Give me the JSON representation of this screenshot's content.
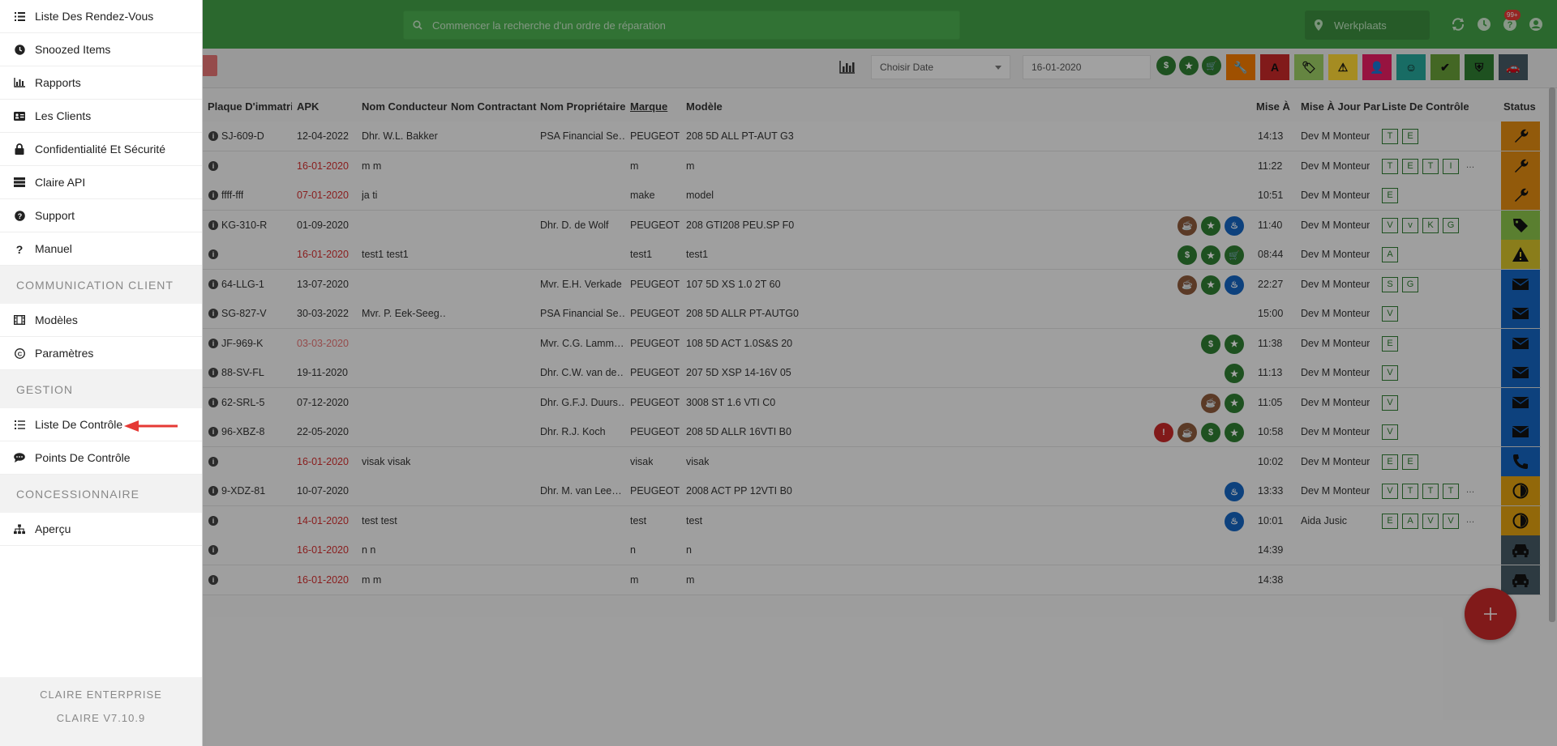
{
  "search": {
    "placeholder": "Commencer la recherche d'un ordre de réparation"
  },
  "location": {
    "label": "Werkplaats"
  },
  "notif_badge": "99+",
  "toolbar": {
    "date_select": "Choisir Date",
    "date_value": "16-01-2020"
  },
  "filters": {
    "circle": [
      {
        "icon": "dollar-icon",
        "color": "#2e7d32"
      },
      {
        "icon": "star-icon",
        "color": "#2e7d32"
      },
      {
        "icon": "cart-icon",
        "color": "#2e7d32"
      }
    ],
    "square": [
      {
        "icon": "wrench-icon",
        "color": "#f57c00"
      },
      {
        "icon": "letter-a-icon",
        "color": "#c62828"
      },
      {
        "icon": "tag-icon",
        "color": "#9ccc65"
      },
      {
        "icon": "warning-icon",
        "color": "#fdd835"
      },
      {
        "icon": "user-plus-icon",
        "color": "#e91e63"
      },
      {
        "icon": "smiley-icon",
        "color": "#26a69a"
      },
      {
        "icon": "double-check-icon",
        "color": "#689f38"
      },
      {
        "icon": "shield-icon",
        "color": "#2e7d32"
      },
      {
        "icon": "car-icon",
        "color": "#455a64"
      }
    ]
  },
  "table": {
    "headers": [
      "Plaque D'immatric",
      "APK",
      "Nom Conducteur",
      "Nom Contractant",
      "Nom Propriétaire",
      "Marque",
      "Modèle",
      "Mise À",
      "Mise À Jour Par",
      "Liste De Contrôle",
      "Status"
    ],
    "rows": [
      {
        "plaque": "SJ-609-D",
        "apk": "12-04-2022",
        "apk_style": "",
        "cond": "Dhr. W.L. Bakker",
        "prop": "PSA Financial Se…",
        "marque": "PEUGEOT",
        "modele": "208 5D ALL PT-AUT G3",
        "mise": "14:13",
        "par": "Dev M Monteur",
        "checks": [
          "T",
          "E"
        ],
        "more": "",
        "icons": [],
        "status": "wrench",
        "status_color": "#e08a12"
      },
      {
        "plaque": "",
        "apk": "16-01-2020",
        "apk_style": "red",
        "cond": "m m",
        "prop": "",
        "marque": "m",
        "modele": "m",
        "mise": "11:22",
        "par": "Dev M Monteur",
        "checks": [
          "T",
          "E",
          "T",
          "I"
        ],
        "more": "…",
        "icons": [],
        "status": "wrench",
        "status_color": "#e08a12"
      },
      {
        "plaque": "ffff-fff",
        "apk": "07-01-2020",
        "apk_style": "red",
        "cond": "ja ti",
        "prop": "",
        "marque": "make",
        "modele": "model",
        "mise": "10:51",
        "par": "Dev M Monteur",
        "checks": [
          "E"
        ],
        "more": "",
        "icons": [],
        "status": "wrench",
        "status_color": "#e08a12"
      },
      {
        "plaque": "KG-310-R",
        "apk": "01-09-2020",
        "apk_style": "",
        "cond": "",
        "prop": "Dhr. D. de Wolf",
        "marque": "PEUGEOT",
        "modele": "208 GTI208 PEU.SP F0",
        "mise": "11:40",
        "par": "Dev M Monteur",
        "checks": [
          "V",
          "v",
          "K",
          "G"
        ],
        "more": "",
        "icons": [
          {
            "c": "#8d5a3b",
            "t": "☕"
          },
          {
            "c": "#2e7d32",
            "t": "★"
          },
          {
            "c": "#1565c0",
            "t": "♨"
          }
        ],
        "status": "tag",
        "status_color": "#8bc34a"
      },
      {
        "plaque": "",
        "apk": "16-01-2020",
        "apk_style": "red",
        "cond": "test1 test1",
        "prop": "",
        "marque": "test1",
        "modele": "test1",
        "mise": "08:44",
        "par": "Dev M Monteur",
        "checks": [
          "A"
        ],
        "more": "",
        "icons": [
          {
            "c": "#2e7d32",
            "t": "$"
          },
          {
            "c": "#2e7d32",
            "t": "★"
          },
          {
            "c": "#2e7d32",
            "t": "🛒"
          }
        ],
        "status": "warning",
        "status_color": "#d4c12a"
      },
      {
        "plaque": "64-LLG-1",
        "apk": "13-07-2020",
        "apk_style": "",
        "cond": "",
        "prop": "Mvr. E.H. Verkade",
        "marque": "PEUGEOT",
        "modele": "107 5D XS 1.0 2T 60",
        "mise": "22:27",
        "par": "Dev M Monteur",
        "checks": [
          "S",
          "G"
        ],
        "more": "",
        "icons": [
          {
            "c": "#8d5a3b",
            "t": "☕"
          },
          {
            "c": "#2e7d32",
            "t": "★"
          },
          {
            "c": "#1565c0",
            "t": "♨"
          }
        ],
        "status": "mail",
        "status_color": "#1565c0"
      },
      {
        "plaque": "SG-827-V",
        "apk": "30-03-2022",
        "apk_style": "",
        "cond": "Mvr. P. Eek-Seeg…",
        "prop": "PSA Financial Se…",
        "marque": "PEUGEOT",
        "modele": "208 5D ALLR PT-AUTG0",
        "mise": "15:00",
        "par": "Dev M Monteur",
        "checks": [
          "V"
        ],
        "more": "",
        "icons": [],
        "status": "mail",
        "status_color": "#1565c0"
      },
      {
        "plaque": "JF-969-K",
        "apk": "03-03-2020",
        "apk_style": "pink",
        "cond": "",
        "prop": "Mvr. C.G. Lamm…",
        "marque": "PEUGEOT",
        "modele": "108 5D ACT 1.0S&S 20",
        "mise": "11:38",
        "par": "Dev M Monteur",
        "checks": [
          "E"
        ],
        "more": "",
        "icons": [
          {
            "c": "#2e7d32",
            "t": "$"
          },
          {
            "c": "#2e7d32",
            "t": "★"
          }
        ],
        "status": "mail",
        "status_color": "#1565c0"
      },
      {
        "plaque": "88-SV-FL",
        "apk": "19-11-2020",
        "apk_style": "",
        "cond": "",
        "prop": "Dhr. C.W. van de…",
        "marque": "PEUGEOT",
        "modele": "207 5D XSP 14-16V 05",
        "mise": "11:13",
        "par": "Dev M Monteur",
        "checks": [
          "V"
        ],
        "more": "",
        "icons": [
          {
            "c": "#2e7d32",
            "t": "★"
          }
        ],
        "status": "mail",
        "status_color": "#1565c0"
      },
      {
        "plaque": "62-SRL-5",
        "apk": "07-12-2020",
        "apk_style": "",
        "cond": "",
        "prop": "Dhr. G.F.J. Duurs…",
        "marque": "PEUGEOT",
        "modele": "3008 ST 1.6 VTI C0",
        "mise": "11:05",
        "par": "Dev M Monteur",
        "checks": [
          "V"
        ],
        "more": "",
        "icons": [
          {
            "c": "#8d5a3b",
            "t": "☕"
          },
          {
            "c": "#2e7d32",
            "t": "★"
          }
        ],
        "status": "mail",
        "status_color": "#1565c0"
      },
      {
        "plaque": "96-XBZ-8",
        "apk": "22-05-2020",
        "apk_style": "",
        "cond": "",
        "prop": "Dhr. R.J. Koch",
        "marque": "PEUGEOT",
        "modele": "208 5D ALLR 16VTI B0",
        "mise": "10:58",
        "par": "Dev M Monteur",
        "checks": [
          "V"
        ],
        "more": "",
        "icons": [
          {
            "c": "#c62828",
            "t": "!"
          },
          {
            "c": "#8d5a3b",
            "t": "☕"
          },
          {
            "c": "#2e7d32",
            "t": "$"
          },
          {
            "c": "#2e7d32",
            "t": "★"
          }
        ],
        "status": "mail",
        "status_color": "#1565c0"
      },
      {
        "plaque": "",
        "apk": "16-01-2020",
        "apk_style": "red",
        "cond": "visak visak",
        "prop": "",
        "marque": "visak",
        "modele": "visak",
        "mise": "10:02",
        "par": "Dev M Monteur",
        "checks": [
          "E",
          "E"
        ],
        "more": "",
        "icons": [],
        "status": "phone",
        "status_color": "#1565c0"
      },
      {
        "plaque": "9-XDZ-81",
        "apk": "10-07-2020",
        "apk_style": "",
        "cond": "",
        "prop": "Dhr. M. van Lee…",
        "marque": "PEUGEOT",
        "modele": "2008 ACT PP 12VTI B0",
        "mise": "13:33",
        "par": "Dev M Monteur",
        "checks": [
          "V",
          "T",
          "T",
          "T"
        ],
        "more": "…",
        "icons": [
          {
            "c": "#1565c0",
            "t": "♨"
          }
        ],
        "status": "clock",
        "status_color": "#e0a010"
      },
      {
        "plaque": "",
        "apk": "14-01-2020",
        "apk_style": "red",
        "cond": "test test",
        "prop": "",
        "marque": "test",
        "modele": "test",
        "mise": "10:01",
        "par": "Aida Jusic",
        "checks": [
          "E",
          "A",
          "V",
          "V"
        ],
        "more": "…",
        "icons": [
          {
            "c": "#1565c0",
            "t": "♨"
          }
        ],
        "status": "clock",
        "status_color": "#e0a010"
      },
      {
        "plaque": "",
        "apk": "16-01-2020",
        "apk_style": "red",
        "cond": "n n",
        "prop": "",
        "marque": "n",
        "modele": "n",
        "mise": "14:39",
        "par": "",
        "checks": [],
        "more": "",
        "icons": [],
        "status": "car",
        "status_color": "#455a64"
      },
      {
        "plaque": "",
        "apk": "16-01-2020",
        "apk_style": "red",
        "cond": "m m",
        "prop": "",
        "marque": "m",
        "modele": "m",
        "mise": "14:38",
        "par": "",
        "checks": [],
        "more": "",
        "icons": [],
        "status": "car",
        "status_color": "#455a64"
      }
    ]
  },
  "sidebar": {
    "items": [
      {
        "label": "Liste Des Rendez-Vous",
        "icon": "list-icon"
      },
      {
        "label": "Snoozed Items",
        "icon": "clock-icon"
      },
      {
        "label": "Rapports",
        "icon": "bar-chart-icon"
      },
      {
        "label": "Les Clients",
        "icon": "id-card-icon"
      },
      {
        "label": "Confidentialité Et Sécurité",
        "icon": "lock-icon"
      },
      {
        "label": "Claire API",
        "icon": "server-icon"
      },
      {
        "label": "Support",
        "icon": "question-circle-icon"
      },
      {
        "label": "Manuel",
        "icon": "question-icon"
      }
    ],
    "section_comm": "COMMUNICATION CLIENT",
    "comm_items": [
      {
        "label": "Modèles",
        "icon": "film-icon"
      },
      {
        "label": "Paramètres",
        "icon": "copyright-icon"
      }
    ],
    "section_gestion": "GESTION",
    "gestion_items": [
      {
        "label": "Liste De Contrôle",
        "icon": "checklist-icon"
      },
      {
        "label": "Points De Contrôle",
        "icon": "comments-icon"
      }
    ],
    "section_conc": "CONCESSIONNAIRE",
    "conc_items": [
      {
        "label": "Aperçu",
        "icon": "sitemap-icon"
      }
    ],
    "footer_line1": "CLAIRE ENTERPRISE",
    "footer_line2": "CLAIRE V7.10.9"
  }
}
